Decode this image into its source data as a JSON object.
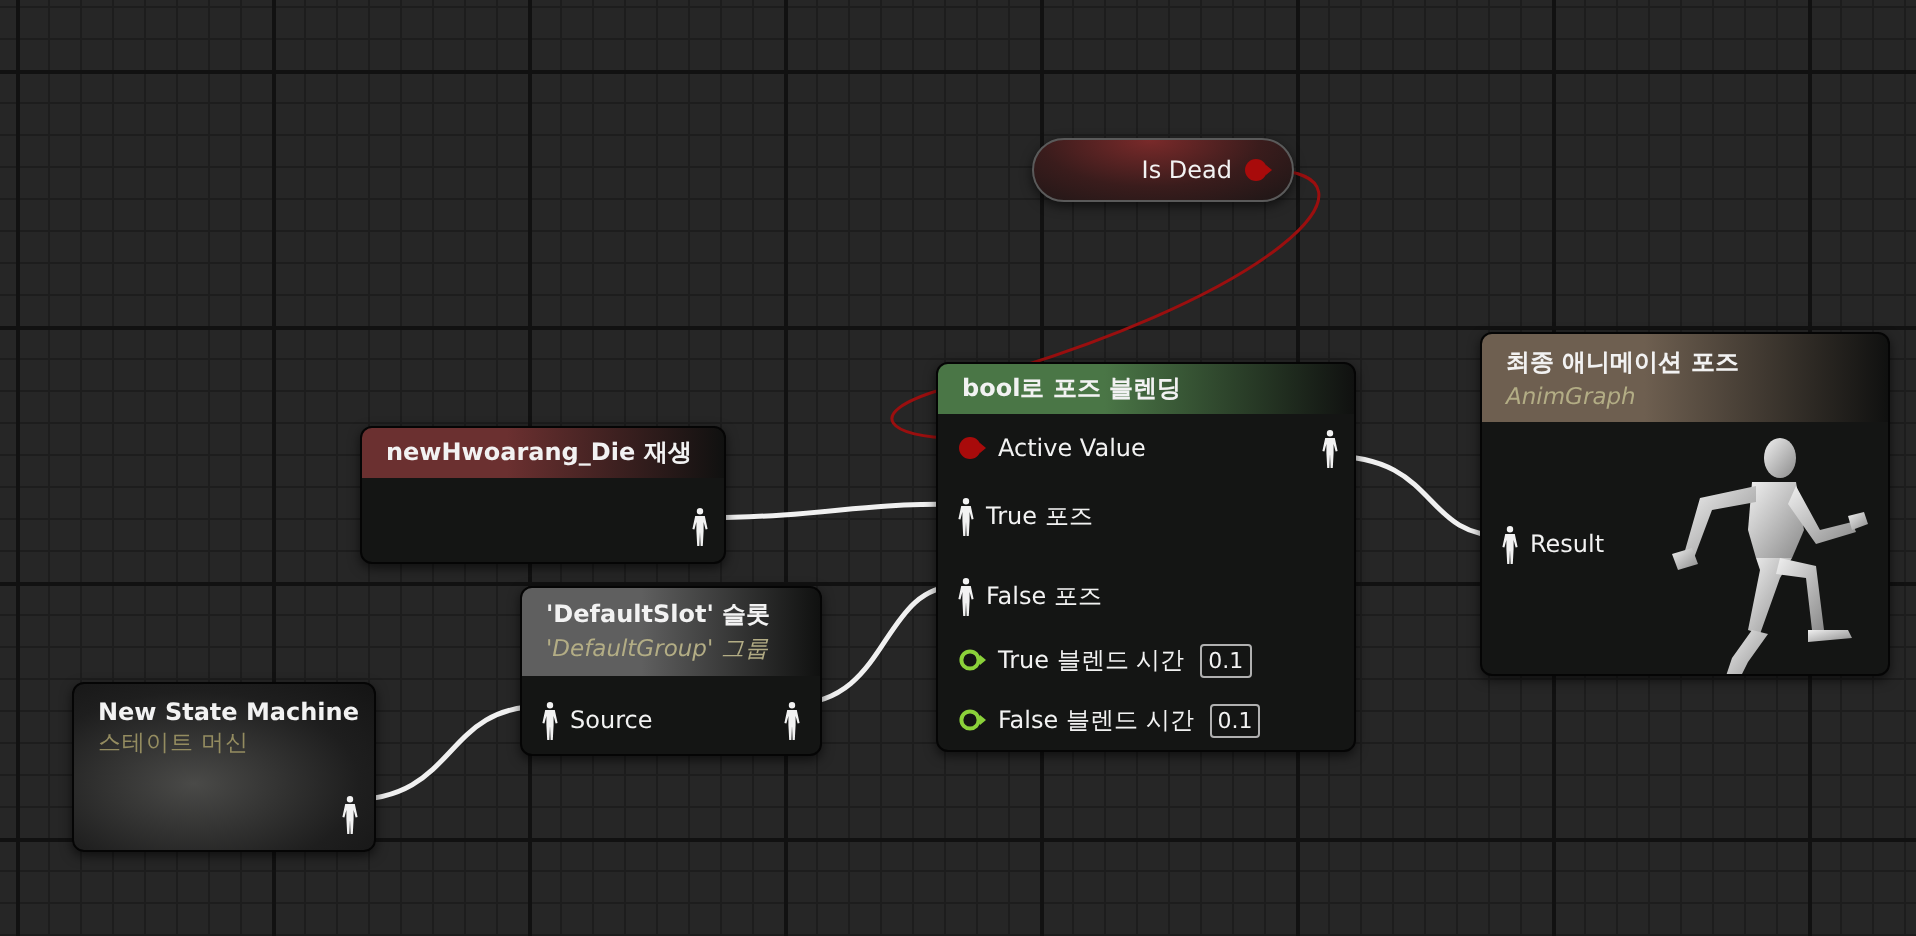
{
  "nodes": [
    {
      "kind": "variable",
      "title": "Is Dead",
      "outputs": [
        {
          "kind": "bool"
        }
      ]
    },
    {
      "kind": "sequence",
      "title": "newHwoarang_Die 재생",
      "color": "#6b3030",
      "outputs": [
        {
          "kind": "pose"
        }
      ]
    },
    {
      "kind": "slot",
      "title": "'DefaultSlot' 슬롯",
      "subtitle": "'DefaultGroup' 그룹",
      "color": "#5f5f5f",
      "inputs": [
        {
          "kind": "pose",
          "label": "Source"
        }
      ],
      "outputs": [
        {
          "kind": "pose"
        }
      ]
    },
    {
      "kind": "statemachine",
      "title": "New State Machine",
      "subtitle": "스테이트 머신",
      "outputs": [
        {
          "kind": "pose"
        }
      ]
    },
    {
      "kind": "blend",
      "title": "bool로 포즈 블렌딩",
      "color": "#4a7646",
      "inputs": [
        {
          "kind": "bool",
          "label": "Active Value"
        },
        {
          "kind": "pose",
          "label": "True 포즈"
        },
        {
          "kind": "pose",
          "label": "False 포즈"
        },
        {
          "kind": "float",
          "label": "True 블렌드 시간",
          "value": "0.1"
        },
        {
          "kind": "float",
          "label": "False 블렌드 시간",
          "value": "0.1"
        }
      ],
      "outputs": [
        {
          "kind": "pose"
        }
      ]
    },
    {
      "kind": "result",
      "title": "최종 애니메이션 포즈",
      "subtitle": "AnimGraph",
      "color": "#6e5f50",
      "inputs": [
        {
          "kind": "pose",
          "label": "Result"
        }
      ]
    }
  ]
}
